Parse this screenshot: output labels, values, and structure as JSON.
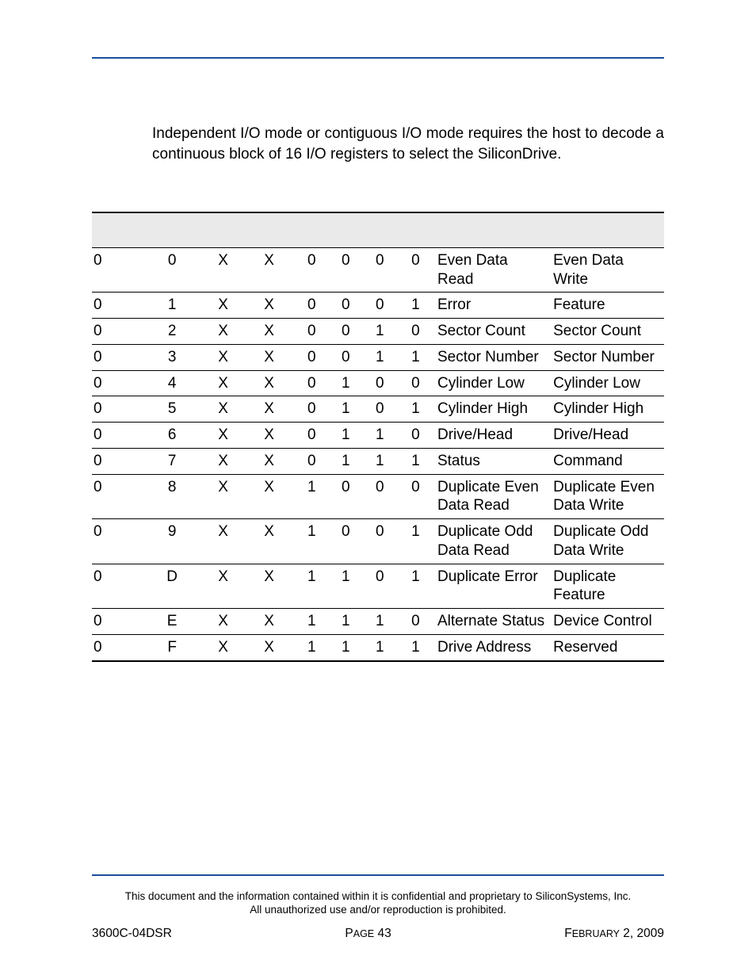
{
  "intro": "Independent I/O mode or contiguous I/O mode requires the host to decode a continuous block of 16 I/O registers to select the SiliconDrive.",
  "table": {
    "rows": [
      {
        "c0": "0",
        "c1": "0",
        "c2": "X",
        "c3": "X",
        "c4": "0",
        "c5": "0",
        "c6": "0",
        "c7": "0",
        "c8": "Even Data Read",
        "c9": "Even Data Write"
      },
      {
        "c0": "0",
        "c1": "1",
        "c2": "X",
        "c3": "X",
        "c4": "0",
        "c5": "0",
        "c6": "0",
        "c7": "1",
        "c8": "Error",
        "c9": "Feature"
      },
      {
        "c0": "0",
        "c1": "2",
        "c2": "X",
        "c3": "X",
        "c4": "0",
        "c5": "0",
        "c6": "1",
        "c7": "0",
        "c8": "Sector Count",
        "c9": "Sector Count"
      },
      {
        "c0": "0",
        "c1": "3",
        "c2": "X",
        "c3": "X",
        "c4": "0",
        "c5": "0",
        "c6": "1",
        "c7": "1",
        "c8": "Sector Number",
        "c9": "Sector Number"
      },
      {
        "c0": "0",
        "c1": "4",
        "c2": "X",
        "c3": "X",
        "c4": "0",
        "c5": "1",
        "c6": "0",
        "c7": "0",
        "c8": "Cylinder Low",
        "c9": "Cylinder Low"
      },
      {
        "c0": "0",
        "c1": "5",
        "c2": "X",
        "c3": "X",
        "c4": "0",
        "c5": "1",
        "c6": "0",
        "c7": "1",
        "c8": "Cylinder High",
        "c9": "Cylinder High"
      },
      {
        "c0": "0",
        "c1": "6",
        "c2": "X",
        "c3": "X",
        "c4": "0",
        "c5": "1",
        "c6": "1",
        "c7": "0",
        "c8": "Drive/Head",
        "c9": "Drive/Head"
      },
      {
        "c0": "0",
        "c1": "7",
        "c2": "X",
        "c3": "X",
        "c4": "0",
        "c5": "1",
        "c6": "1",
        "c7": "1",
        "c8": "Status",
        "c9": "Command"
      },
      {
        "c0": "0",
        "c1": "8",
        "c2": "X",
        "c3": "X",
        "c4": "1",
        "c5": "0",
        "c6": "0",
        "c7": "0",
        "c8": "Duplicate Even Data Read",
        "c9": "Duplicate Even Data Write"
      },
      {
        "c0": "0",
        "c1": "9",
        "c2": "X",
        "c3": "X",
        "c4": "1",
        "c5": "0",
        "c6": "0",
        "c7": "1",
        "c8": "Duplicate Odd Data Read",
        "c9": "Duplicate Odd Data Write"
      },
      {
        "c0": "0",
        "c1": "D",
        "c2": "X",
        "c3": "X",
        "c4": "1",
        "c5": "1",
        "c6": "0",
        "c7": "1",
        "c8": "Duplicate Error",
        "c9": "Duplicate Feature"
      },
      {
        "c0": "0",
        "c1": "E",
        "c2": "X",
        "c3": "X",
        "c4": "1",
        "c5": "1",
        "c6": "1",
        "c7": "0",
        "c8": "Alternate Status",
        "c9": "Device Control"
      },
      {
        "c0": "0",
        "c1": "F",
        "c2": "X",
        "c3": "X",
        "c4": "1",
        "c5": "1",
        "c6": "1",
        "c7": "1",
        "c8": "Drive Address",
        "c9": "Reserved"
      }
    ]
  },
  "disclaimer_line1": "This document and the information contained within it is confidential and proprietary to SiliconSystems, Inc.",
  "disclaimer_line2": "All unauthorized use and/or reproduction is prohibited.",
  "footer": {
    "left": "3600C-04DSR",
    "center_prefix": "P",
    "center_smallcaps": "AGE",
    "center_num": " 43",
    "right_prefix": "F",
    "right_smallcaps": "EBRUARY",
    "right_rest": " 2, 2009"
  }
}
